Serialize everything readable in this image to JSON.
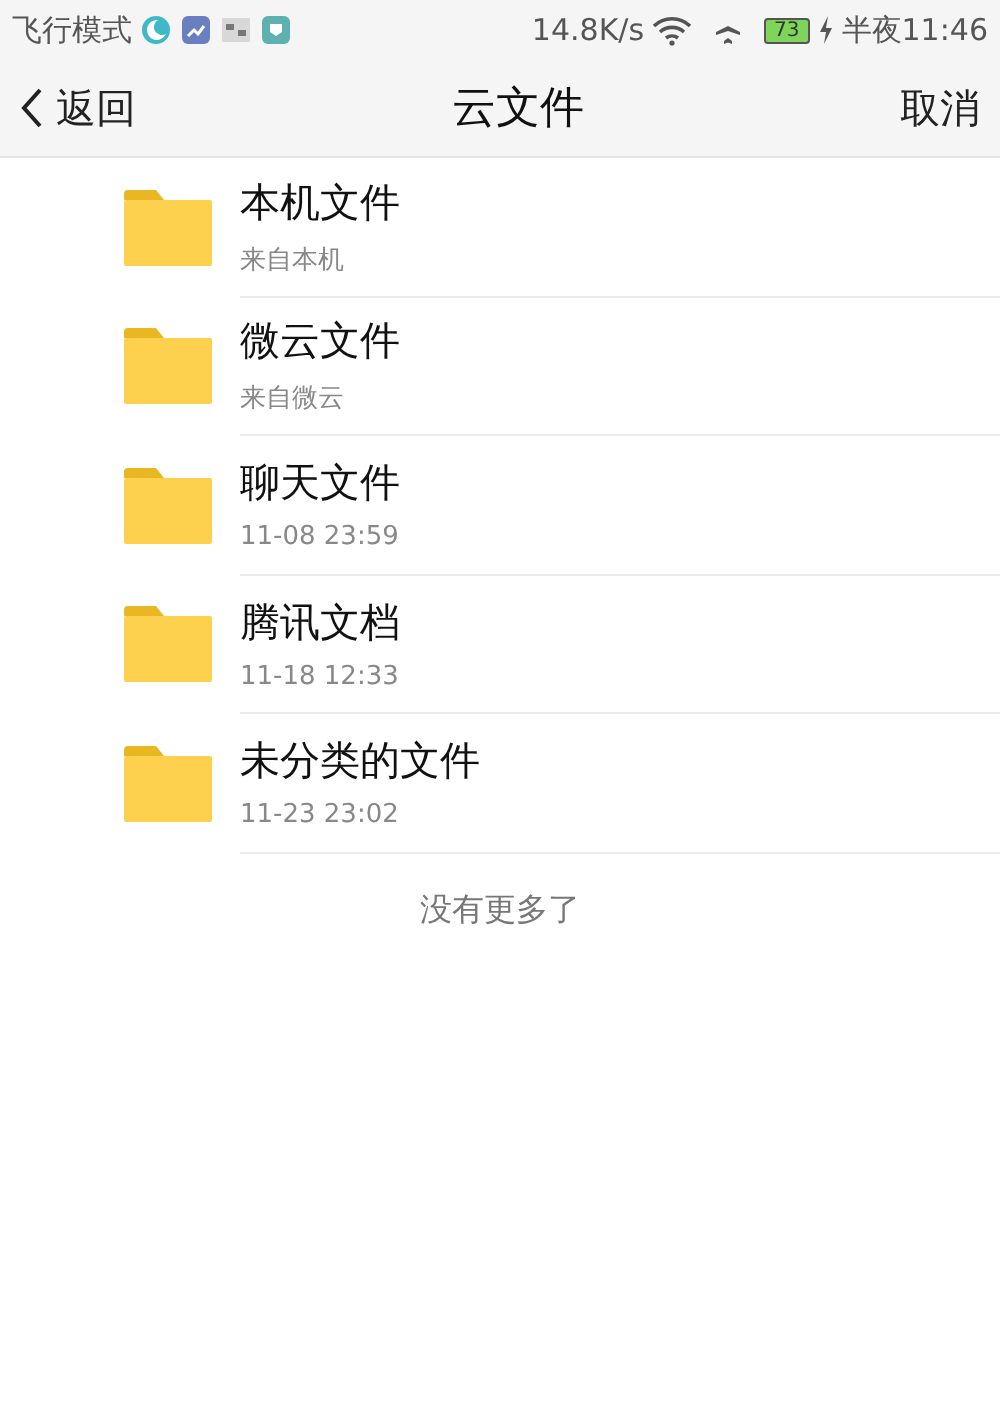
{
  "status_bar": {
    "mode": "飞行模式",
    "speed": "14.8K/s",
    "battery": "73",
    "time": "半夜11:46"
  },
  "nav": {
    "back": "返回",
    "title": "云文件",
    "cancel": "取消"
  },
  "folders": [
    {
      "name": "本机文件",
      "subtitle": "来自本机"
    },
    {
      "name": "微云文件",
      "subtitle": "来自微云"
    },
    {
      "name": "聊天文件",
      "subtitle": "11-08 23:59"
    },
    {
      "name": "腾讯文档",
      "subtitle": "11-18 12:33"
    },
    {
      "name": "未分类的文件",
      "subtitle": "11-23 23:02"
    }
  ],
  "footer": "没有更多了"
}
